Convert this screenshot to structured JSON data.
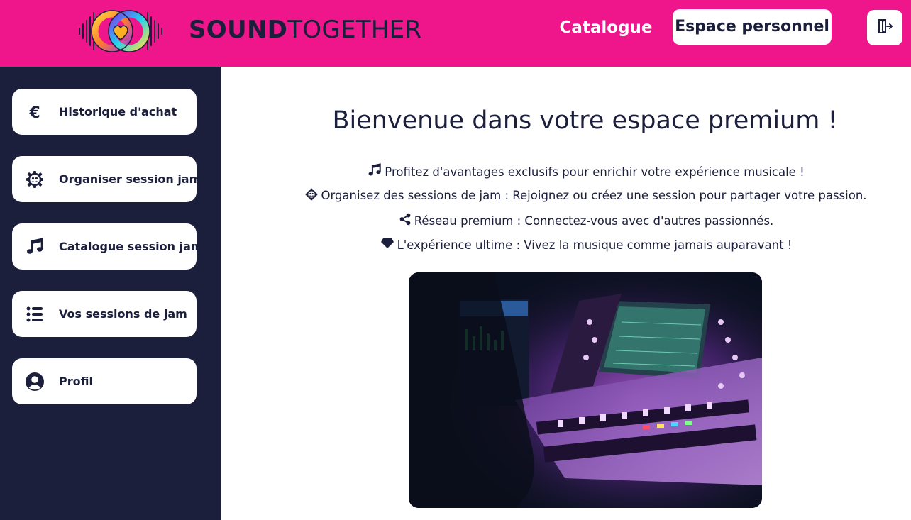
{
  "header": {
    "brand_bold": "SOUND",
    "brand_light": "TOGETHER",
    "nav_catalogue": "Catalogue",
    "nav_espace": "Espace personnel",
    "logout_icon": "logout-icon"
  },
  "sidebar": {
    "items": [
      {
        "label": "Historique d'achat",
        "icon": "euro-icon"
      },
      {
        "label": "Organiser session jam",
        "icon": "gear-people-icon"
      },
      {
        "label": "Catalogue session jam",
        "icon": "music-note-icon"
      },
      {
        "label": "Vos sessions de jam",
        "icon": "list-icon"
      },
      {
        "label": "Profil",
        "icon": "user-circle-icon"
      }
    ]
  },
  "main": {
    "title": "Bienvenue dans votre espace premium !",
    "features": [
      {
        "text": "Profitez d'avantages exclusifs pour enrichir votre expérience musicale !",
        "icon": "music-note-icon"
      },
      {
        "text": "Organisez des sessions de jam : Rejoignez ou créez une session pour partager votre passion.",
        "icon": "gear-people-icon"
      },
      {
        "text": "Réseau premium : Connectez-vous avec d'autres passionnés.",
        "icon": "share-icon"
      },
      {
        "text": "L'expérience ultime : Vivez la musique comme jamais auparavant !",
        "icon": "diamond-icon"
      }
    ]
  },
  "colors": {
    "header_bg": "#ee168a",
    "sidebar_bg": "#1b1f3b",
    "text_dark": "#1b1f3b"
  }
}
